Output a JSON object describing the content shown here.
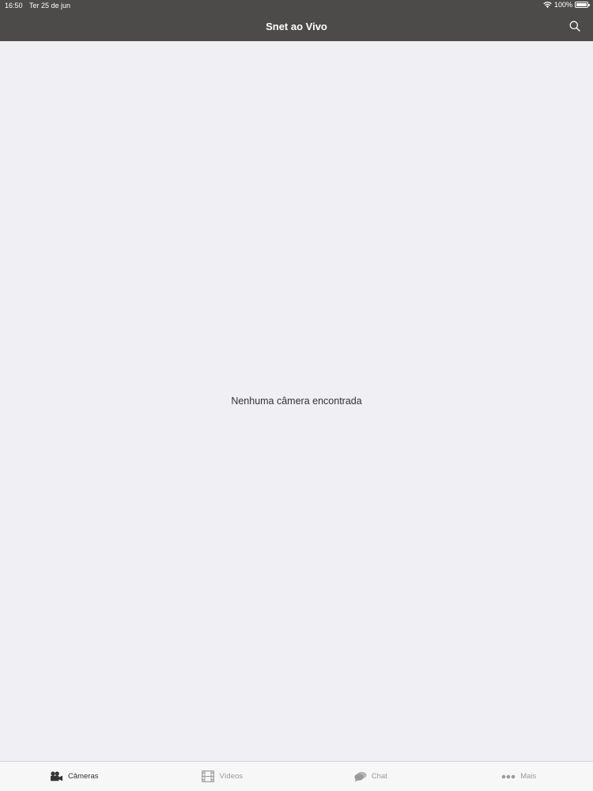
{
  "status_bar": {
    "time": "16:50",
    "date": "Ter 25 de jun",
    "battery": "100%"
  },
  "nav": {
    "title": "Snet ao Vivo"
  },
  "content": {
    "empty_message": "Nenhuma câmera encontrada"
  },
  "tabs": [
    {
      "label": "Câmeras",
      "icon": "video-camera-icon",
      "active": true
    },
    {
      "label": "Vídeos",
      "icon": "film-icon",
      "active": false
    },
    {
      "label": "Chat",
      "icon": "chat-bubbles-icon",
      "active": false
    },
    {
      "label": "Mais",
      "icon": "more-dots-icon",
      "active": false
    }
  ],
  "colors": {
    "nav_bg": "#4d4b4a",
    "content_bg": "#efeff4",
    "tab_active": "#333333",
    "tab_inactive": "#9a9a9a"
  }
}
